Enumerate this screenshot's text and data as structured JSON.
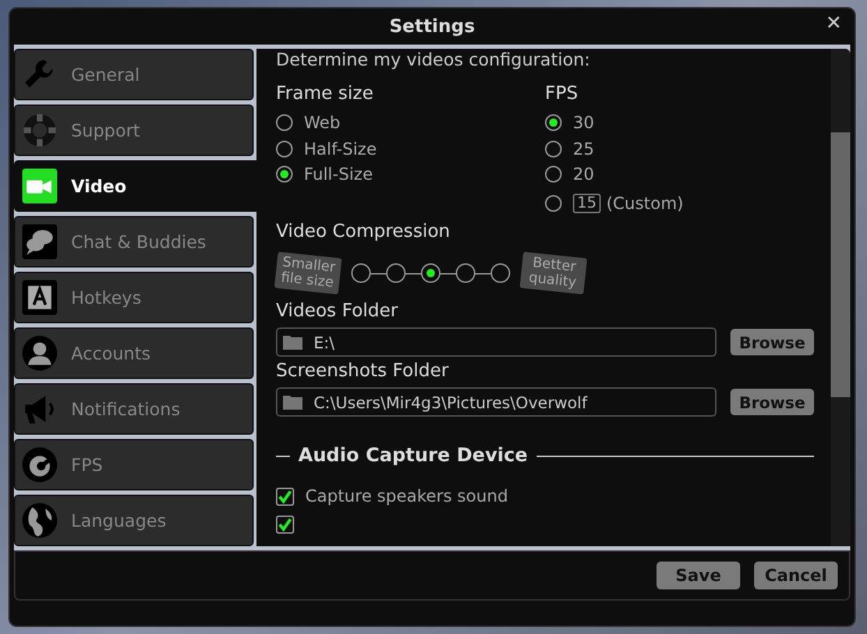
{
  "window": {
    "title": "Settings",
    "close": "✕"
  },
  "sidebar": {
    "items": [
      {
        "label": "General",
        "selected": false
      },
      {
        "label": "Support",
        "selected": false
      },
      {
        "label": "Video",
        "selected": true
      },
      {
        "label": "Chat & Buddies",
        "selected": false
      },
      {
        "label": "Hotkeys",
        "selected": false
      },
      {
        "label": "Accounts",
        "selected": false
      },
      {
        "label": "Notifications",
        "selected": false
      },
      {
        "label": "FPS",
        "selected": false
      },
      {
        "label": "Languages",
        "selected": false
      }
    ]
  },
  "content": {
    "intro": "Determine my videos configuration:",
    "frame_size": {
      "title": "Frame size",
      "options": [
        {
          "label": "Web",
          "selected": false
        },
        {
          "label": "Half-Size",
          "selected": false
        },
        {
          "label": "Full-Size",
          "selected": true
        }
      ]
    },
    "fps": {
      "title": "FPS",
      "options": [
        {
          "label": "30",
          "selected": true
        },
        {
          "label": "25",
          "selected": false
        },
        {
          "label": "20",
          "selected": false
        },
        {
          "custom_field": "15",
          "note": "(Custom)",
          "selected": false
        }
      ]
    },
    "compression": {
      "title": "Video Compression",
      "low_label": "Smaller file size",
      "high_label": "Better quality",
      "steps": [
        {
          "selected": false
        },
        {
          "selected": false
        },
        {
          "selected": true
        },
        {
          "selected": false
        },
        {
          "selected": false
        }
      ]
    },
    "folders": [
      {
        "title": "Videos Folder",
        "value": "E:\\",
        "button": "Browse"
      },
      {
        "title": "Screenshots Folder",
        "value": "C:\\Users\\Mir4g3\\Pictures\\Overwolf",
        "button": "Browse"
      }
    ],
    "audio": {
      "title": "Audio Capture Device",
      "options": [
        {
          "label": "Capture speakers sound",
          "checked": true
        },
        {
          "checked": true
        }
      ]
    }
  },
  "buttons": [
    "Save",
    "Cancel"
  ]
}
